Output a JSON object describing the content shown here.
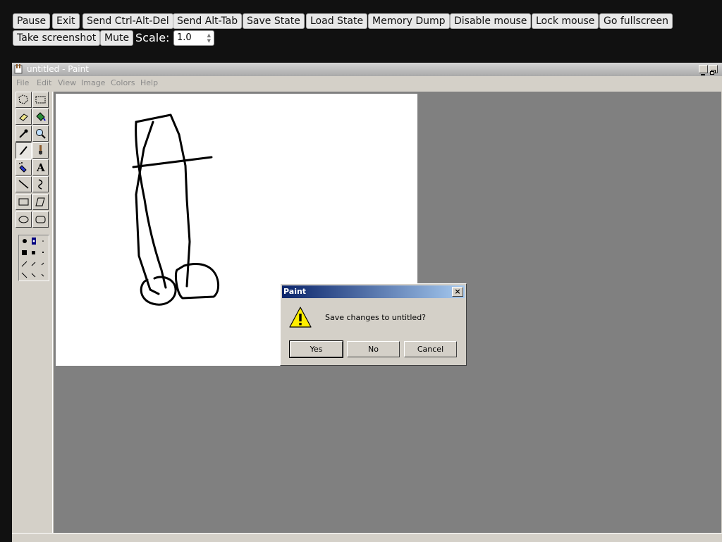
{
  "emulator": {
    "buttons": [
      "Pause",
      "Exit",
      "Send Ctrl-Alt-Del",
      "Send Alt-Tab",
      "Save State",
      "Load State",
      "Memory Dump",
      "Disable mouse",
      "Lock mouse",
      "Go fullscreen",
      "Take screenshot",
      "Mute"
    ],
    "scale_label": "Scale:",
    "scale_value": "1.0"
  },
  "window": {
    "title": "untitled - Paint",
    "menus": [
      "File",
      "Edit",
      "View",
      "Image",
      "Colors",
      "Help"
    ]
  },
  "tools": [
    "free-form-select",
    "select",
    "eraser",
    "fill-with-color",
    "pick-color",
    "magnifier",
    "pencil",
    "brush",
    "airbrush",
    "text",
    "line",
    "curve",
    "rectangle",
    "polygon",
    "ellipse",
    "rounded-rectangle"
  ],
  "selected_tool": "pencil",
  "dialog": {
    "title": "Paint",
    "message": "Save changes to untitled?",
    "buttons": [
      "Yes",
      "No",
      "Cancel"
    ]
  }
}
